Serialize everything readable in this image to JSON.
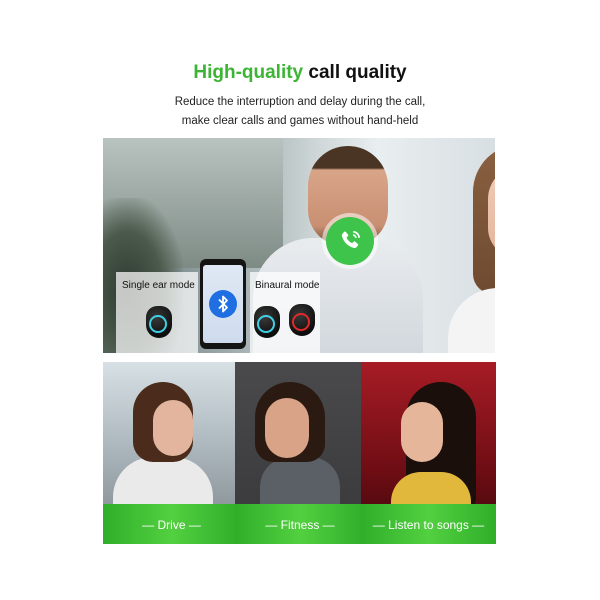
{
  "header": {
    "title_highlight": "High-quality",
    "title_rest": " call quality",
    "subtitle_line1": "Reduce the interruption and delay during the call,",
    "subtitle_line2": "make clear calls and games without hand-held"
  },
  "modes": {
    "single": "Single ear mode",
    "binaural": "Binaural mode"
  },
  "scenes": [
    {
      "caption": "— Drive —"
    },
    {
      "caption": "— Fitness —"
    },
    {
      "caption": "— Listen to songs —"
    }
  ],
  "colors": {
    "accent_green": "#3cb534",
    "call_button": "#3ec44a",
    "bluetooth_blue": "#1f6fe3",
    "earbud_ring_cyan": "#3fd0e4",
    "earbud_ring_red": "#e02a2a"
  },
  "icons": {
    "call": "phone-handset-icon",
    "bluetooth": "bluetooth-icon"
  }
}
